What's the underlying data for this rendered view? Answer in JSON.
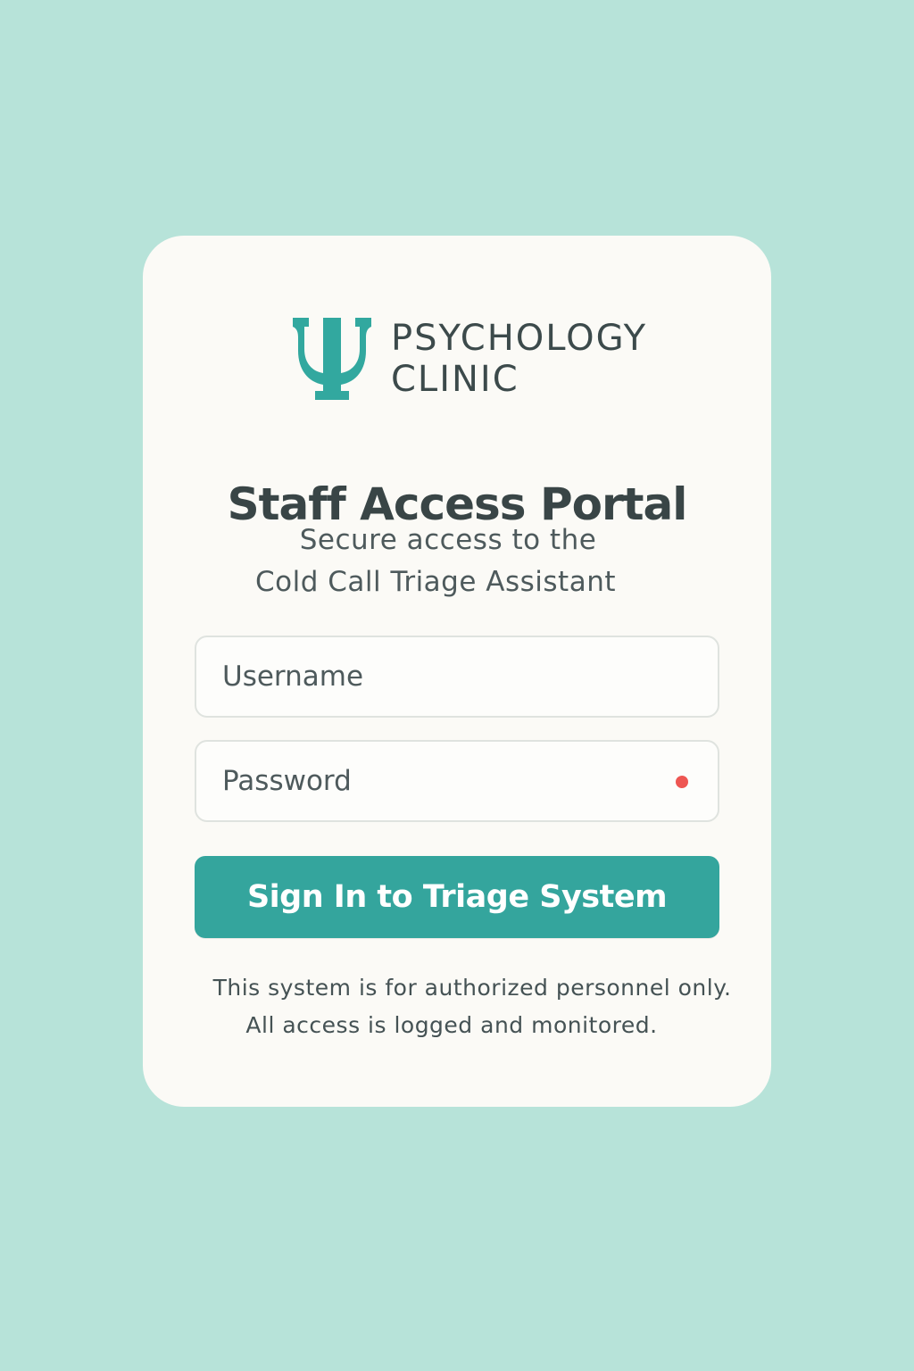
{
  "logo": {
    "icon": "psi-icon",
    "line1": "PSYCHOLOGY",
    "line2": "CLINIC",
    "icon_color": "#32a89f"
  },
  "title": "Staff Access Portal",
  "subtitle": {
    "line1": "Secure access to the",
    "line2": "Cold Call Triage Assistant"
  },
  "username": {
    "placeholder": "Username",
    "value": ""
  },
  "password": {
    "placeholder": "Password",
    "value": "",
    "status_icon": "error-dot-icon",
    "status_color": "#ee5652"
  },
  "signin_button": {
    "label": "Sign In to Triage System",
    "color": "#34a59d"
  },
  "notice": {
    "line1": "This system is for authorized personnel only.",
    "line2": "All access is logged and monitored."
  },
  "colors": {
    "background": "#b7e3d9",
    "card": "#fbfaf6",
    "text": "#394546",
    "accent": "#34a59d"
  }
}
